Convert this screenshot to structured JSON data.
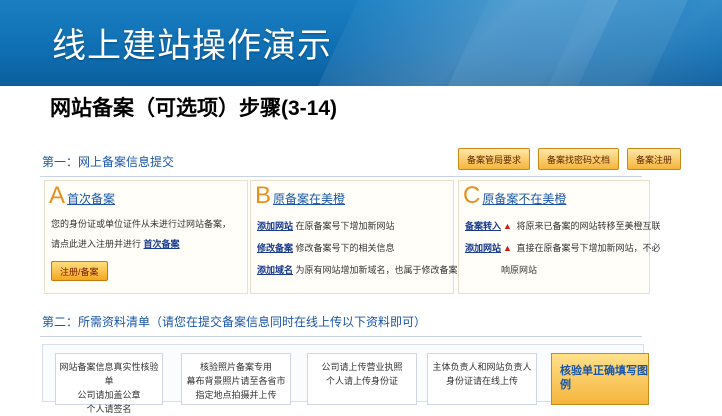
{
  "banner": {
    "title": "线上建站操作演示"
  },
  "subtitle": "网站备案（可选项）步骤(3-14)",
  "section1": {
    "header": "第一：网上备案信息提交",
    "buttons": [
      "备案管局要求",
      "备案找密码文档",
      "备案注册"
    ]
  },
  "panelA": {
    "letter": "A",
    "title": "首次备案",
    "line1": "您的身份证或单位证件从未进行过网站备案，",
    "line2_pre": "请点此进入注册并进行",
    "line2_link": "首次备案",
    "button": "注册/备案"
  },
  "panelB": {
    "letter": "B",
    "title": "原备案在美橙",
    "rows": [
      {
        "key": "添加网站",
        "text": "在原备案号下增加新网站"
      },
      {
        "key": "修改备案",
        "text": "修改备案号下的相关信息"
      },
      {
        "key": "添加域名",
        "text": "为原有网站增加新域名，也属于修改备案"
      }
    ]
  },
  "panelC": {
    "letter": "C",
    "title": "原备案不在美橙",
    "rows": [
      {
        "key": "备案转入",
        "text": "将原来已备案的网站转移至美橙互联"
      },
      {
        "key": "添加网站",
        "text": "直接在原备案号下增加新网站，不必"
      },
      {
        "key": "",
        "text": "响原网站"
      }
    ]
  },
  "section2": {
    "header": "第二：所需资料清单（请您在提交备案信息同时在线上传以下资料即可）",
    "cards": [
      {
        "l1": "网站备案信息真实性核验单",
        "l2": "公司请加盖公章",
        "l3": "个人请签名"
      },
      {
        "l1": "核验照片备案专用",
        "l2": "幕布背景照片请至各省市",
        "l3": "指定地点拍摄并上传"
      },
      {
        "l1": "公司请上传营业执照",
        "l2": "个人请上传身份证",
        "l3": ""
      },
      {
        "l1": "主体负责人和网站负责人",
        "l2": "身份证请在线上传",
        "l3": ""
      }
    ],
    "highlight": "核验单正确填写图例"
  }
}
